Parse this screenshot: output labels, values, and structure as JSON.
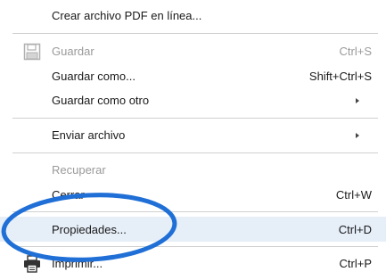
{
  "menu": {
    "items": [
      {
        "key": "create_pdf",
        "label": "Crear archivo PDF en línea...",
        "shortcut": "",
        "submenu": false,
        "disabled": false
      },
      {
        "key": "save",
        "label": "Guardar",
        "shortcut": "Ctrl+S",
        "submenu": false,
        "disabled": true,
        "icon": "floppy-disk-icon"
      },
      {
        "key": "save_as",
        "label": "Guardar como...",
        "shortcut": "Shift+Ctrl+S",
        "submenu": false,
        "disabled": false
      },
      {
        "key": "save_other",
        "label": "Guardar como otro",
        "shortcut": "",
        "submenu": true,
        "disabled": false
      },
      {
        "key": "send_file",
        "label": "Enviar archivo",
        "shortcut": "",
        "submenu": true,
        "disabled": false
      },
      {
        "key": "recover",
        "label": "Recuperar",
        "shortcut": "",
        "submenu": false,
        "disabled": true
      },
      {
        "key": "close",
        "label": "Cerrar",
        "shortcut": "Ctrl+W",
        "submenu": false,
        "disabled": false
      },
      {
        "key": "properties",
        "label": "Propiedades...",
        "shortcut": "Ctrl+D",
        "submenu": false,
        "disabled": false,
        "highlighted": true
      },
      {
        "key": "print",
        "label": "Imprimir...",
        "shortcut": "Ctrl+P",
        "submenu": false,
        "disabled": false,
        "icon": "printer-icon"
      }
    ]
  },
  "annotation": {
    "type": "ellipse",
    "color": "#1f6fd6",
    "target": "properties"
  }
}
